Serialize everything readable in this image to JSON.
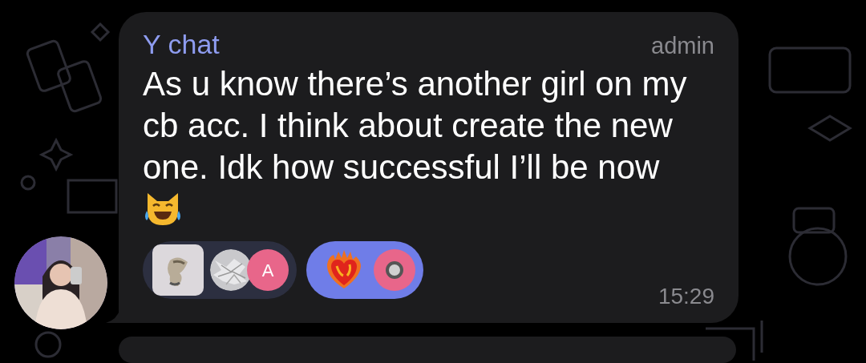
{
  "message": {
    "sender": "Y chat",
    "badge": "admin",
    "text": "As u know there’s another girl on my cb acc. I think about create the new one. Idk how successful I’ll be now",
    "reactions": [
      {
        "selected": false,
        "kind": "sticker",
        "avatars": [
          {
            "kind": "picture"
          },
          {
            "kind": "letter",
            "letter": "A",
            "color": "#e8668a"
          }
        ]
      },
      {
        "selected": true,
        "kind": "fire-heart",
        "avatars": [
          {
            "kind": "dot",
            "color": "#e8668a"
          }
        ]
      }
    ],
    "time": "15:29"
  }
}
